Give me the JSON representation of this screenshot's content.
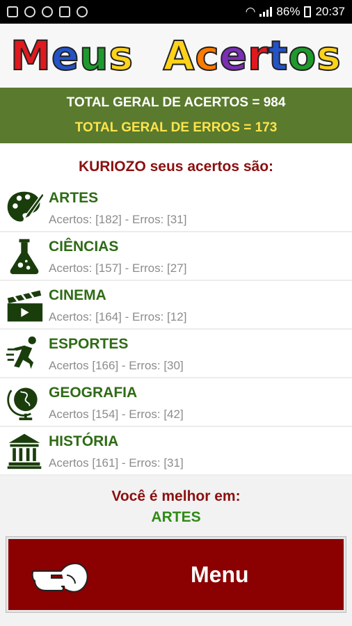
{
  "status_bar": {
    "battery": "86%",
    "time": "20:37"
  },
  "banner": {
    "word1": "Meus",
    "word2": "Acertos"
  },
  "totals": {
    "hits": "TOTAL GERAL DE ACERTOS = 984",
    "errors": "TOTAL GERAL DE ERROS = 173"
  },
  "greeting": "KURIOZO seus acertos são:",
  "categories": [
    {
      "name": "ARTES",
      "stats": "Acertos: [182] - Erros: [31]",
      "icon": "palette-icon"
    },
    {
      "name": "CIÊNCIAS",
      "stats": "Acertos: [157] -  Erros: [27]",
      "icon": "flask-icon"
    },
    {
      "name": "CINEMA",
      "stats": "Acertos: [164] - Erros: [12]",
      "icon": "clapperboard-icon"
    },
    {
      "name": "ESPORTES",
      "stats": "Acertos [166] - Erros: [30]",
      "icon": "runner-icon"
    },
    {
      "name": "GEOGRAFIA",
      "stats": "Acertos [154] - Erros: [42]",
      "icon": "globe-icon"
    },
    {
      "name": "HISTÓRIA",
      "stats": "Acertos [161] - Erros: [31]",
      "icon": "museum-icon"
    }
  ],
  "best": {
    "label": "Você é melhor em:",
    "value": "ARTES"
  },
  "menu": {
    "label": "Menu"
  },
  "colors": {
    "header_green": "#5a7a2e",
    "category_green": "#2e6b15",
    "accent_red": "#8b0000",
    "errors_yellow": "#ffe44c"
  }
}
